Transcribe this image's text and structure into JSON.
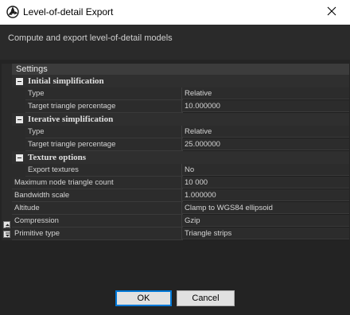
{
  "window": {
    "title": "Level-of-detail Export",
    "icon": "app-logo-icon",
    "close_icon": "close-icon"
  },
  "description": "Compute and export level-of-detail models",
  "grid": {
    "header": "Settings",
    "categories": [
      {
        "label": "Initial simplification",
        "rows": [
          {
            "name": "Type",
            "value": "Relative"
          },
          {
            "name": "Target triangle percentage",
            "value": "10.000000"
          }
        ]
      },
      {
        "label": "Iterative simplification",
        "rows": [
          {
            "name": "Type",
            "value": "Relative"
          },
          {
            "name": "Target triangle percentage",
            "value": "25.000000"
          }
        ]
      },
      {
        "label": "Texture options",
        "rows": [
          {
            "name": "Export textures",
            "value": "No"
          }
        ]
      }
    ],
    "top_rows": [
      {
        "name": "Maximum node triangle count",
        "value": "10 000"
      },
      {
        "name": "Bandwidth scale",
        "value": "1.000000"
      },
      {
        "name": "Altitude",
        "value": "Clamp to WGS84 ellipsoid"
      },
      {
        "name": "Compression",
        "value": "Gzip"
      },
      {
        "name": "Primitive type",
        "value": "Triangle strips"
      }
    ],
    "side_icons": [
      "expand-all-icon",
      "collapse-all-icon"
    ]
  },
  "buttons": {
    "ok": "OK",
    "cancel": "Cancel"
  },
  "colors": {
    "accent": "#0078d7",
    "background": "#242424",
    "grid_header": "#3c3c3c"
  }
}
